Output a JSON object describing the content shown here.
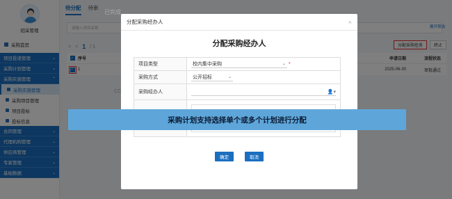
{
  "sidebar": {
    "user_name": "招采管理",
    "home_label": "采购首页",
    "groups_top": [
      {
        "label": "项目投递管理",
        "chev": "⌄"
      },
      {
        "label": "采购计划管理",
        "chev": "⌄"
      },
      {
        "label": "采购实施管理",
        "chev": "⌃"
      }
    ],
    "sub_items": [
      {
        "label": "采购实施管理"
      },
      {
        "label": "采购项目管理"
      },
      {
        "label": "项目投标"
      },
      {
        "label": "投标信息"
      }
    ],
    "groups_bottom": [
      {
        "label": "合同管理",
        "chev": "⌄"
      },
      {
        "label": "代理机构管理",
        "chev": "⌄"
      },
      {
        "label": "供应商管理",
        "chev": "⌄"
      },
      {
        "label": "专家管理",
        "chev": "⌄"
      },
      {
        "label": "基础数据",
        "chev": "⌄"
      }
    ]
  },
  "main": {
    "tabs": [
      {
        "label": "待分配"
      },
      {
        "label": "待审"
      }
    ],
    "tab_hidden": "已完成",
    "search_placeholder": "请输入项目名称",
    "advanced_search": "展开筛选",
    "pager_prev": "<",
    "pager_first": "<",
    "pager_page": "1",
    "pager_total": "/ 1",
    "toolbar": {
      "assign": "分配采购任务",
      "stop": "终止"
    },
    "table": {
      "headers": {
        "no": "序号",
        "date": "申请日期",
        "status": "流程状态"
      },
      "rows": [
        {
          "no": "1",
          "date": "2025-06-30",
          "status": "审批通过"
        }
      ]
    },
    "bg_fragment_1": "CC",
    "bg_fragment_2": "门"
  },
  "modal": {
    "header": "分配采购经办人",
    "close": "×",
    "title": "分配采购经办人",
    "fields": {
      "project_type_label": "项目类型",
      "project_type_value": "校内集中采购",
      "method_label": "采购方式",
      "method_value": "公开招标",
      "handler_label": "采购经办人",
      "handler_icon": "👤▾"
    },
    "confirm": "确定",
    "cancel": "取消"
  },
  "banner": {
    "text": "采购计划支持选择单个或多个计划进行分配"
  },
  "colors": {
    "primary": "#1a6fc0",
    "highlight": "#e03030",
    "banner": "#5ea6d9"
  }
}
